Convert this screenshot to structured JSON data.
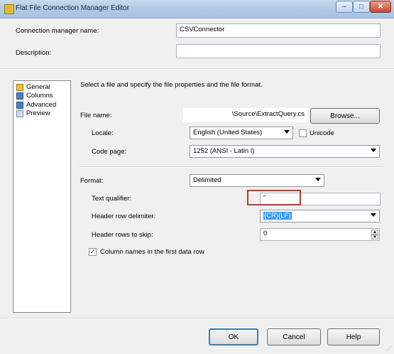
{
  "window": {
    "title": "Flat File Connection Manager Editor",
    "controls": {
      "minimize": "–",
      "maximize": "□",
      "close": "✕"
    }
  },
  "connection_name": {
    "label": "Connection manager name:",
    "value": "CSVConnector"
  },
  "description": {
    "label": "Description:",
    "value": ""
  },
  "sidebar": {
    "items": [
      {
        "label": "General",
        "icon": "general-icon"
      },
      {
        "label": "Columns",
        "icon": "columns-icon"
      },
      {
        "label": "Advanced",
        "icon": "advanced-icon"
      },
      {
        "label": "Preview",
        "icon": "preview-icon"
      }
    ]
  },
  "intro_text": "Select a file and specify the file properties and the file format.",
  "file_name": {
    "label": "File name:",
    "value": "\\Source\\ExtractQuery.cs",
    "browse_label": "Browse..."
  },
  "locale": {
    "label": "Locale:",
    "value": "English (United States)",
    "unicode_label": "Unicode",
    "unicode_checked": false
  },
  "code_page": {
    "label": "Code page:",
    "value": "1252  (ANSI - Latin I)"
  },
  "format": {
    "label": "Format:",
    "value": "Delimited"
  },
  "text_qualifier": {
    "label": "Text qualifier:",
    "value": "\""
  },
  "header_row_delimiter": {
    "label": "Header row delimiter:",
    "value": "{CR}{LF}"
  },
  "header_rows_to_skip": {
    "label": "Header rows to skip:",
    "value": "0"
  },
  "column_names_first_row": {
    "label": "Column names in the first data row",
    "checked": true
  },
  "footer": {
    "ok_label": "OK",
    "cancel_label": "Cancel",
    "help_label": "Help"
  },
  "colors": {
    "highlight_box": "#c0392b",
    "selection": "#3399ff",
    "titlebar": "#b9d1ea"
  }
}
